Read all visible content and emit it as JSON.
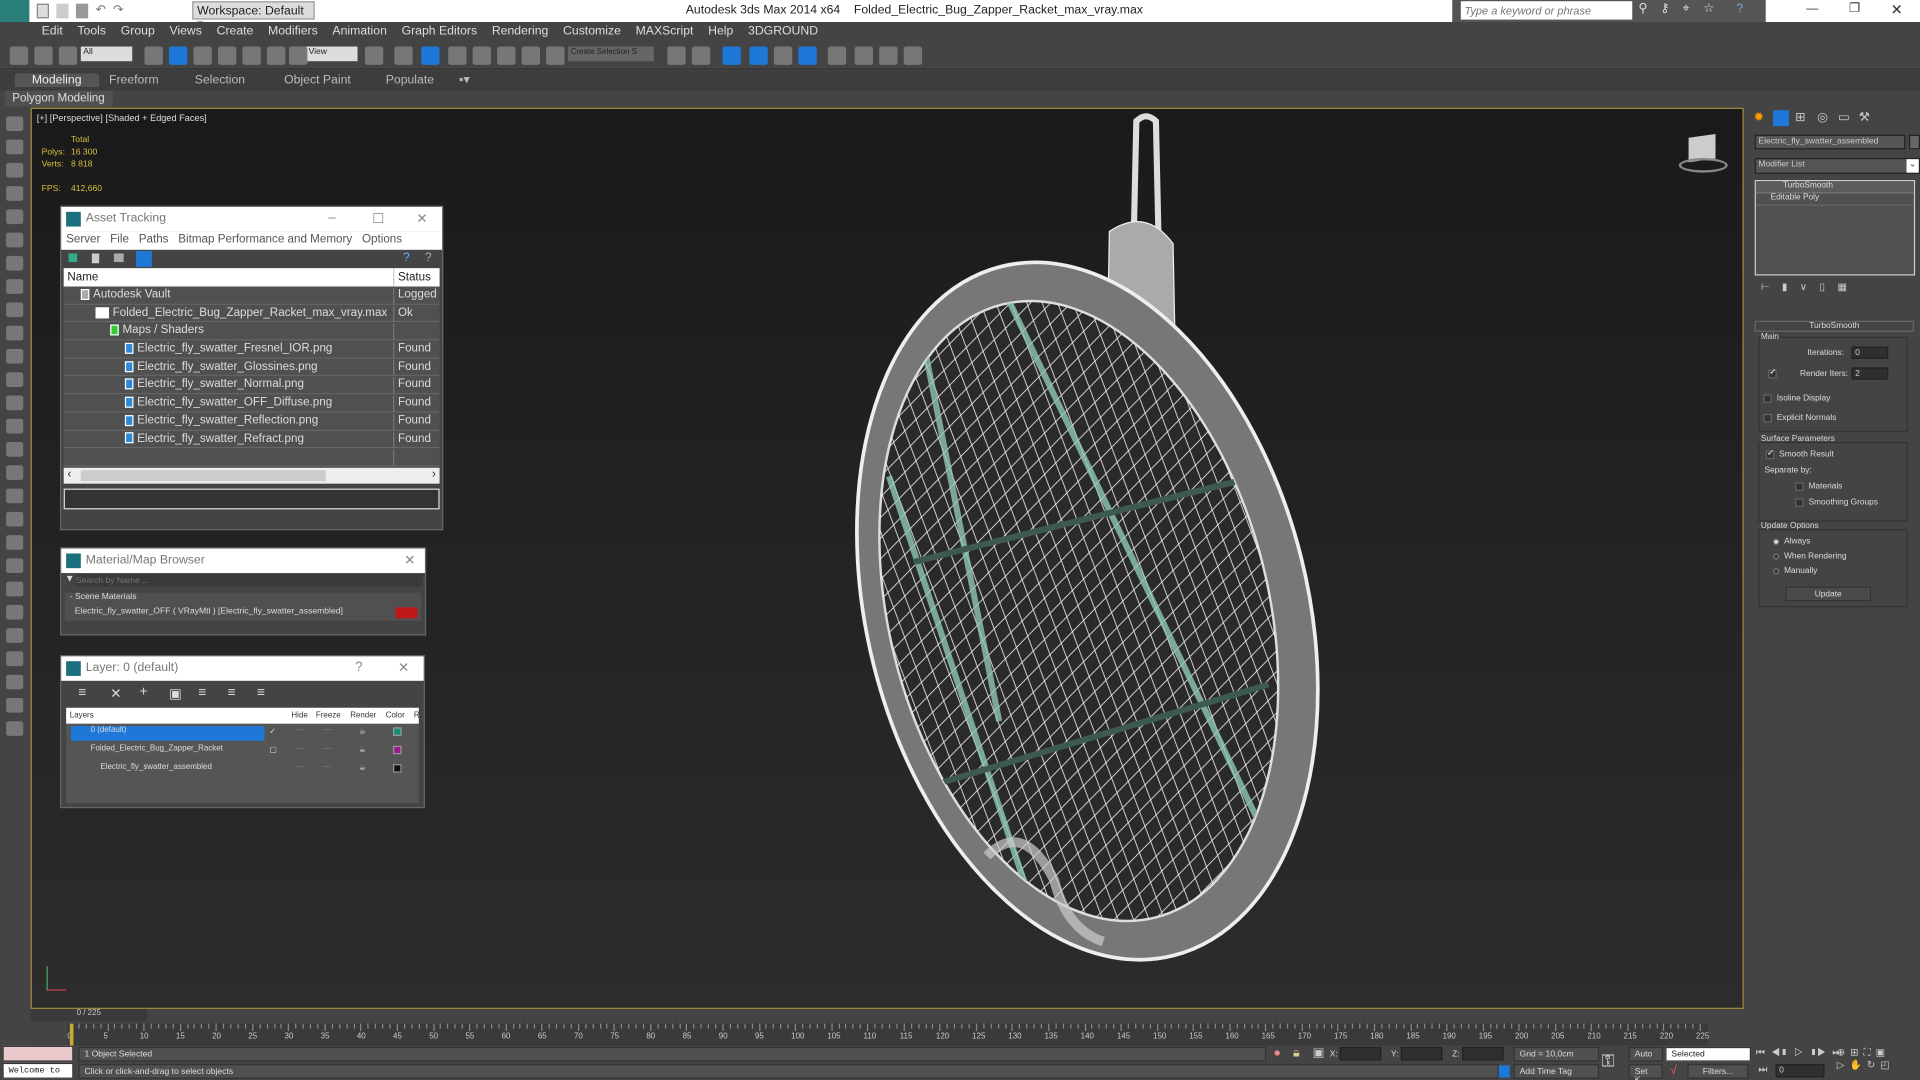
{
  "app": {
    "title": "Autodesk 3ds Max  2014 x64",
    "file": "Folded_Electric_Bug_Zapper_Racket_max_vray.max",
    "workspace": "Workspace: Default",
    "search_placeholder": "Type a keyword or phrase"
  },
  "menu": [
    "Edit",
    "Tools",
    "Group",
    "Views",
    "Create",
    "Modifiers",
    "Animation",
    "Graph Editors",
    "Rendering",
    "Customize",
    "MAXScript",
    "Help",
    "3DGROUND"
  ],
  "toolbar": {
    "filter": "All",
    "refcoord": "View",
    "selection_set": "Create Selection S"
  },
  "ribbon": {
    "tabs": [
      "Modeling",
      "Freeform",
      "Selection",
      "Object Paint",
      "Populate"
    ],
    "active": "Modeling",
    "sub": "Polygon Modeling"
  },
  "viewport": {
    "label": "[+] [Perspective] [Shaded + Edged Faces]",
    "total": "Total",
    "polys_label": "Polys:",
    "polys": "16 300",
    "verts_label": "Verts:",
    "verts": "8 818",
    "fps_label": "FPS:",
    "fps": "412,660"
  },
  "asset_tracking": {
    "title": "Asset Tracking",
    "menu": [
      "Server",
      "File",
      "Paths",
      "Bitmap Performance and Memory",
      "Options"
    ],
    "col_name": "Name",
    "col_status": "Status",
    "rows": [
      {
        "name": "Autodesk Vault",
        "status": "Logged",
        "indent": 1
      },
      {
        "name": "Folded_Electric_Bug_Zapper_Racket_max_vray.max",
        "status": "Ok",
        "indent": 2
      },
      {
        "name": "Maps / Shaders",
        "status": "",
        "indent": 3
      },
      {
        "name": "Electric_fly_swatter_Fresnel_IOR.png",
        "status": "Found",
        "indent": 4
      },
      {
        "name": "Electric_fly_swatter_Glossines.png",
        "status": "Found",
        "indent": 4
      },
      {
        "name": "Electric_fly_swatter_Normal.png",
        "status": "Found",
        "indent": 4
      },
      {
        "name": "Electric_fly_swatter_OFF_Diffuse.png",
        "status": "Found",
        "indent": 4
      },
      {
        "name": "Electric_fly_swatter_Reflection.png",
        "status": "Found",
        "indent": 4
      },
      {
        "name": "Electric_fly_swatter_Refract.png",
        "status": "Found",
        "indent": 4
      }
    ]
  },
  "material_browser": {
    "title": "Material/Map Browser",
    "search_placeholder": "Search by Name ...",
    "group": "- Scene Materials",
    "item": "Electric_fly_swatter_OFF  ( VRayMtl ) [Electric_fly_swatter_assembled]"
  },
  "layer": {
    "title": "Layer: 0 (default)",
    "cols": [
      "Layers",
      "Hide",
      "Freeze",
      "Render",
      "Color",
      "R"
    ],
    "rows": [
      {
        "name": "0 (default)",
        "color": "#1a8a78",
        "selected": true
      },
      {
        "name": "Folded_Electric_Bug_Zapper_Racket",
        "color": "#9a1a8a",
        "selected": false
      },
      {
        "name": "Electric_fly_swatter_assembled",
        "color": "#111111",
        "selected": false
      }
    ]
  },
  "command_panel": {
    "object_name": "Electric_fly_swatter_assembled",
    "modifier_list": "Modifier List",
    "stack": [
      "TurboSmooth",
      "Editable Poly"
    ],
    "rollout": "TurboSmooth",
    "main": "Main",
    "iterations_label": "Iterations:",
    "iterations": "0",
    "render_iters_label": "Render Iters:",
    "render_iters": "2",
    "render_iters_checked": true,
    "isoline": "Isoline Display",
    "explicit_normals": "Explicit Normals",
    "surface_params": "Surface Parameters",
    "smooth_result": "Smooth Result",
    "separate_by": "Separate by:",
    "materials": "Materials",
    "smoothing_groups": "Smoothing Groups",
    "update_options": "Update Options",
    "always": "Always",
    "when_rendering": "When Rendering",
    "manually": "Manually",
    "update_button": "Update",
    "selected_update": "Always"
  },
  "timeline": {
    "frame": "0 / 225",
    "ticks": [
      0,
      5,
      10,
      15,
      20,
      25,
      30,
      35,
      40,
      45,
      50,
      55,
      60,
      65,
      70,
      75,
      80,
      85,
      90,
      95,
      100,
      105,
      110,
      115,
      120,
      125,
      130,
      135,
      140,
      145,
      150,
      155,
      160,
      165,
      170,
      175,
      180,
      185,
      190,
      195,
      200,
      205,
      210,
      215,
      220,
      225
    ]
  },
  "status": {
    "welcome": "Welcome to",
    "selected": "1 Object Selected",
    "prompt": "Click or click-and-drag to select objects",
    "x_label": "X:",
    "y_label": "Y:",
    "z_label": "Z:",
    "grid": "Grid = 10,0cm",
    "add_time_tag": "Add Time Tag",
    "auto": "Auto",
    "set_key": "Set K.",
    "key_filter": "Selected",
    "filters": "Filters...",
    "current_frame": "0"
  },
  "colors": {
    "accent": "#1e78d8",
    "viewport_border": "#a08a3c",
    "stats": "#d8c040",
    "wire": "#e8e8e8",
    "mesh_green": "#8fc9b0"
  }
}
